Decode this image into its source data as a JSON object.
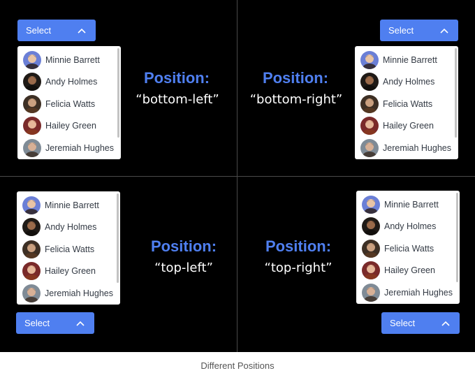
{
  "select_label": "Select",
  "accent_color": "#4f7ff0",
  "people": [
    {
      "name": "Minnie Barrett",
      "avatar": "avatar-icon-minnie"
    },
    {
      "name": "Andy Holmes",
      "avatar": "avatar-icon-andy"
    },
    {
      "name": "Felicia Watts",
      "avatar": "avatar-icon-felicia"
    },
    {
      "name": "Hailey Green",
      "avatar": "avatar-icon-hailey"
    },
    {
      "name": "Jeremiah Hughes",
      "avatar": "avatar-icon-jeremiah"
    }
  ],
  "panels": {
    "bottom_left": {
      "title": "Position:",
      "value": "“bottom-left”"
    },
    "bottom_right": {
      "title": "Position:",
      "value": "“bottom-right”"
    },
    "top_left": {
      "title": "Position:",
      "value": "“top-left”"
    },
    "top_right": {
      "title": "Position:",
      "value": "“top-right”"
    }
  },
  "caption": "Different Positions"
}
